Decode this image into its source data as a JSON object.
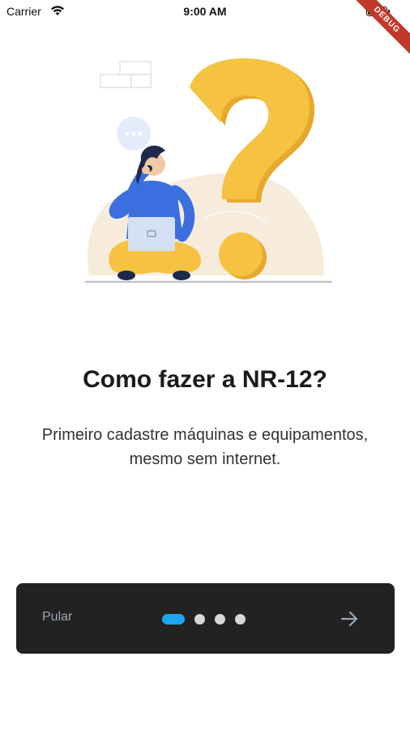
{
  "status_bar": {
    "carrier": "Carrier",
    "time": "9:00 AM",
    "debug_label": "DEBUG"
  },
  "onboarding": {
    "title": "Como fazer a NR-12?",
    "description": "Primeiro cadastre máquinas e equipamentos, mesmo sem internet.",
    "skip_label": "Pular",
    "page_count": 4,
    "active_page": 1
  },
  "colors": {
    "bar_background": "#222222",
    "active_dot": "#1ea7f0",
    "inactive_dot": "#d7d7d7",
    "question_mark": "#f5c242",
    "debug_ribbon": "#c0392b"
  },
  "icons": {
    "next": "arrow-right-icon",
    "wifi": "wifi-icon",
    "battery": "battery-icon"
  }
}
